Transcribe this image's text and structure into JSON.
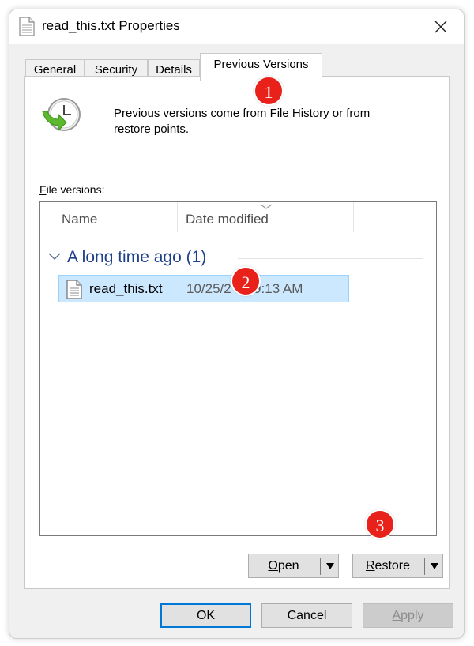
{
  "window": {
    "title": "read_this.txt Properties"
  },
  "tabs": [
    {
      "label": "General"
    },
    {
      "label": "Security"
    },
    {
      "label": "Details"
    },
    {
      "label": "Previous Versions"
    }
  ],
  "active_tab": "Previous Versions",
  "panel": {
    "description_line1": "Previous versions come from File History or from",
    "description_line2": "restore points.",
    "file_versions_label_hotkey": "F",
    "file_versions_label_rest": "ile versions:"
  },
  "listview": {
    "columns": [
      "Name",
      "Date modified"
    ],
    "group": {
      "title": "A long time ago (1)"
    },
    "rows": [
      {
        "name": "read_this.txt",
        "date": "10/25/2      9:13 AM",
        "selected": true
      }
    ]
  },
  "actions": {
    "open_hotkey": "O",
    "open_rest": "pen",
    "restore_hotkey": "R",
    "restore_rest": "estore"
  },
  "footer": {
    "ok": "OK",
    "cancel": "Cancel",
    "apply_hotkey": "A",
    "apply_rest": "pply"
  },
  "markers": [
    {
      "label": "1"
    },
    {
      "label": "2"
    },
    {
      "label": "3"
    }
  ],
  "colors": {
    "selection_bg": "#cce8ff",
    "group_title": "#1e3f8a",
    "marker": "#e8221b",
    "default_button_border": "#0078d7"
  }
}
